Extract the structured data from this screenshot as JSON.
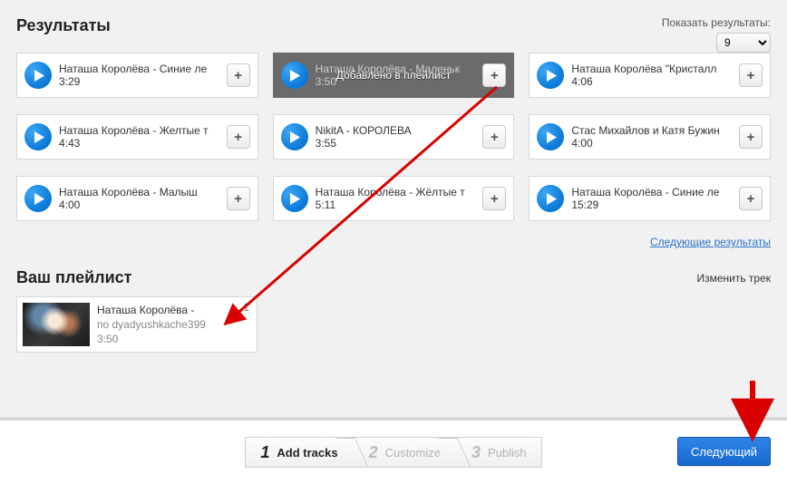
{
  "header": {
    "results_title": "Результаты",
    "show_results_label": "Показать результаты:",
    "show_results_value": "9"
  },
  "results": [
    {
      "title": "Наташа Королёва - Синие ле",
      "duration": "3:29"
    },
    {
      "title": "Наташа Королёва - Маленьк",
      "duration": "3:50",
      "confirming": true,
      "overlay": "Добавлено в плейлист"
    },
    {
      "title": "Наташа Королёва \"Кристалл",
      "duration": "4:06"
    },
    {
      "title": "Наташа Королёва - Желтые т",
      "duration": "4:43"
    },
    {
      "title": "NikitA - КОРОЛЕВА",
      "duration": "3:55"
    },
    {
      "title": "Стас Михайлов и Катя Бужин",
      "duration": "4:00"
    },
    {
      "title": "Наташа Королёва - Малыш",
      "duration": "4:00"
    },
    {
      "title": "Наташа Королёва - Жёлтые т",
      "duration": "5:11"
    },
    {
      "title": "Наташа Королёва - Синие ле",
      "duration": "15:29"
    }
  ],
  "links": {
    "next_results": "Следующие результаты",
    "edit_track": "Изменить трек"
  },
  "playlist": {
    "title": "Ваш плейлист",
    "item": {
      "index": "1",
      "line1": "Наташа Королёва -",
      "line2": "по dyadyushkache399",
      "line3": "3:50"
    }
  },
  "footer": {
    "steps": [
      {
        "num": "1",
        "label": "Add tracks",
        "active": true
      },
      {
        "num": "2",
        "label": "Customize",
        "active": false
      },
      {
        "num": "3",
        "label": "Publish",
        "active": false
      }
    ],
    "next_label": "Следующий"
  },
  "icons": {
    "add": "+"
  }
}
